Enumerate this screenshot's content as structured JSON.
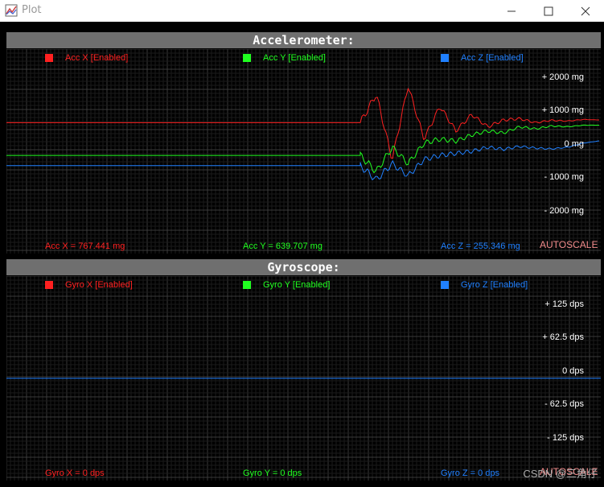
{
  "window": {
    "title": "Plot",
    "icon": "chart-icon"
  },
  "accelerometer": {
    "title": "Accelerometer:",
    "legend": [
      {
        "label": "Acc X [Enabled]",
        "color": "#ff2020"
      },
      {
        "label": "Acc Y [Enabled]",
        "color": "#20ff20"
      },
      {
        "label": "Acc Z [Enabled]",
        "color": "#2080ff"
      }
    ],
    "ticks": [
      "+ 2000 mg",
      "+ 1000 mg",
      "0 mg",
      "- 1000 mg",
      "- 2000 mg"
    ],
    "readouts": [
      "Acc X = 767.441 mg",
      "Acc Y = 639.707 mg",
      "Acc Z = 255.346 mg"
    ],
    "autoscale": "AUTOSCALE"
  },
  "gyroscope": {
    "title": "Gyroscope:",
    "legend": [
      {
        "label": "Gyro X [Enabled]",
        "color": "#ff2020"
      },
      {
        "label": "Gyro Y [Enabled]",
        "color": "#20ff20"
      },
      {
        "label": "Gyro Z [Enabled]",
        "color": "#2080ff"
      }
    ],
    "ticks": [
      "+ 125 dps",
      "+ 62.5 dps",
      "0 dps",
      "- 62.5 dps",
      "- 125 dps"
    ],
    "readouts": [
      "Gyro X = 0 dps",
      "Gyro Y = 0 dps",
      "Gyro Z = 0 dps"
    ],
    "autoscale": "AUTOSCALE"
  },
  "watermark": "CSDN @三角仔",
  "chart_data": [
    {
      "type": "line",
      "title": "Accelerometer:",
      "ylabel": "mg",
      "ylim": [
        -2500,
        2500
      ],
      "grid": true,
      "legend": "top",
      "series": [
        {
          "name": "Acc X [Enabled]",
          "color": "#ff2020",
          "baseline": 700,
          "disturbed": [
            700,
            1400,
            -200,
            1600,
            300,
            1100,
            500,
            900,
            600,
            767,
            800,
            700,
            760,
            740,
            780,
            767
          ]
        },
        {
          "name": "Acc Y [Enabled]",
          "color": "#20ff20",
          "baseline": -100,
          "disturbed": [
            -100,
            -500,
            100,
            -300,
            200,
            300,
            250,
            400,
            500,
            450,
            600,
            550,
            620,
            600,
            640,
            640
          ]
        },
        {
          "name": "Acc Z [Enabled]",
          "color": "#2080ff",
          "baseline": -350,
          "disturbed": [
            -350,
            -700,
            -300,
            -600,
            -200,
            -100,
            -50,
            0,
            100,
            50,
            120,
            80,
            60,
            100,
            200,
            255
          ]
        }
      ]
    },
    {
      "type": "line",
      "title": "Gyroscope:",
      "ylabel": "dps",
      "ylim": [
        -150,
        150
      ],
      "grid": true,
      "legend": "top",
      "series": [
        {
          "name": "Gyro X [Enabled]",
          "color": "#ff2020",
          "value": 0
        },
        {
          "name": "Gyro Y [Enabled]",
          "color": "#20ff20",
          "value": 0
        },
        {
          "name": "Gyro Z [Enabled]",
          "color": "#2080ff",
          "value": 0
        }
      ]
    }
  ]
}
